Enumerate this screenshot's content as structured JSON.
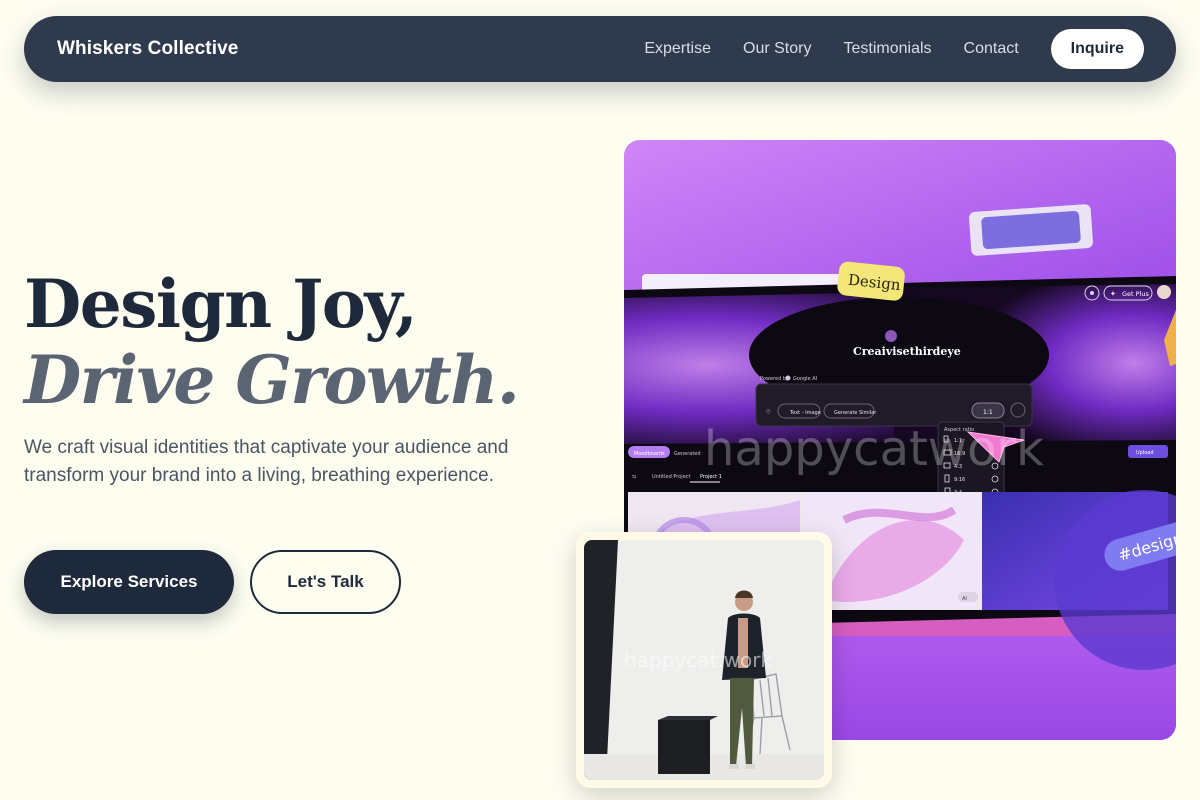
{
  "nav": {
    "brand": "Whiskers Collective",
    "links": [
      "Expertise",
      "Our Story",
      "Testimonials",
      "Contact"
    ],
    "cta": "Inquire"
  },
  "hero": {
    "title_line1": "Design Joy,",
    "title_line2": "Drive Growth.",
    "subtitle": "We craft visual identities that captivate your audience and transform your brand into a living, breathing experience.",
    "primary_button": "Explore Services",
    "secondary_button": "Let's Talk"
  },
  "main_image": {
    "sticker_label": "Design",
    "app_logo": "Creaivisethirdeye",
    "get_plus": "Get Plus",
    "powered_by": "Powered by",
    "google_ai": "Google AI",
    "text_image_chip": "Text - Image",
    "generate_similar_chip": "Generate Similar",
    "aspect_button": "1:1",
    "aspect_ratio_title": "Aspect ratio",
    "aspect_options": [
      "1:1",
      "16:9",
      "4:3",
      "9:16",
      "3:4"
    ],
    "tabs": [
      "Moodboards",
      "Generated"
    ],
    "upload_button": "Upload",
    "project_tabs": [
      "Untitled Project",
      "Project 1"
    ],
    "hashtag": "#designfl",
    "watermark": "happycatwork",
    "ai_badge": "AI"
  },
  "photo": {
    "watermark": "happycat.work"
  },
  "colors": {
    "background": "#fdfdf0",
    "nav_bg": "#2f3b4d",
    "ink": "#1e2a3c",
    "muted": "#5b6472",
    "purple": "#9b44e6"
  }
}
